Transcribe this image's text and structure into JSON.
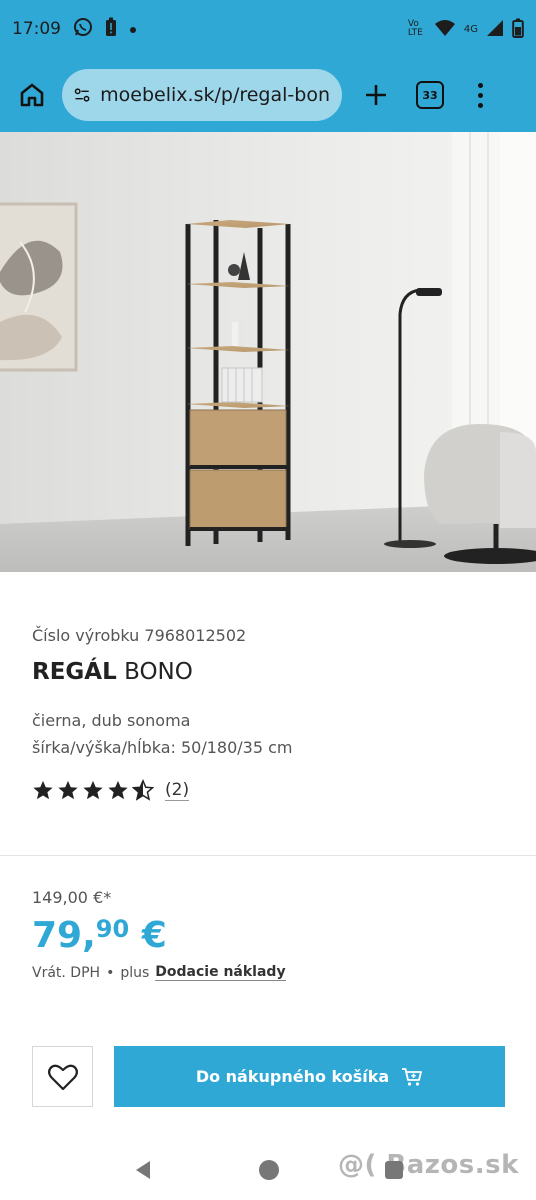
{
  "status": {
    "time": "17:09",
    "network": "4G",
    "volte": "Vo LTE"
  },
  "browser": {
    "url": "moebelix.sk/p/regal-bon",
    "tab_count": "33"
  },
  "product": {
    "article_label": "Číslo výrobku 7968012502",
    "title_bold": "REGÁL",
    "title_rest": " BONO",
    "desc_color": "čierna, dub sonoma",
    "desc_dims": "šírka/výška/hĺbka: 50/180/35 cm",
    "rating_value": 4.5,
    "rating_count": "(2)"
  },
  "price": {
    "old": "149,00 €*",
    "new_whole": "79,",
    "new_cents": "90",
    "new_currency": " €",
    "vat": "Vrát. DPH",
    "bullet": "•",
    "plus": "plus",
    "shipping_link": "Dodacie náklady"
  },
  "actions": {
    "cart_label": "Do nákupného košíka"
  },
  "watermark": "@( Bazos.sk",
  "colors": {
    "accent": "#2fa8d6"
  }
}
